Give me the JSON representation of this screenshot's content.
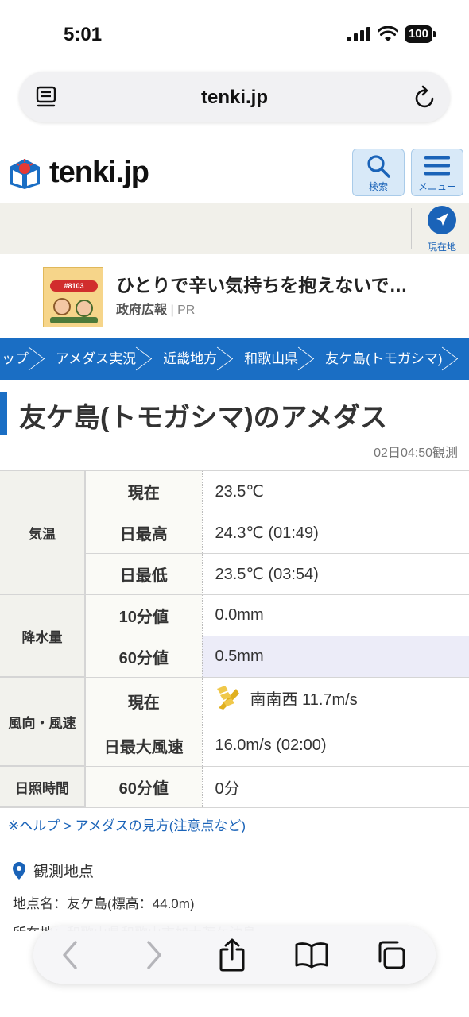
{
  "status_bar": {
    "time": "5:01",
    "battery": "100"
  },
  "browser": {
    "domain": "tenki.jp"
  },
  "site": {
    "logo_text": "tenki.jp",
    "search_label": "検索",
    "menu_label": "メニュー",
    "location_label": "現在地"
  },
  "ad": {
    "badge_text": "#8103",
    "title": "ひとりで辛い気持ちを抱えないで…",
    "sponsor": "政府広報",
    "pr": "PR"
  },
  "breadcrumb": [
    "ップ",
    "アメダス実況",
    "近畿地方",
    "和歌山県",
    "友ケ島(トモガシマ)"
  ],
  "page": {
    "title": "友ケ島(トモガシマ)のアメダス",
    "observed": "02日04:50観測"
  },
  "table": {
    "temp": {
      "category": "気温",
      "rows": [
        {
          "label": "現在",
          "value": "23.5℃"
        },
        {
          "label": "日最高",
          "value": "24.3℃ (01:49)"
        },
        {
          "label": "日最低",
          "value": "23.5℃ (03:54)"
        }
      ]
    },
    "precip": {
      "category": "降水量",
      "rows": [
        {
          "label": "10分値",
          "value": "0.0mm"
        },
        {
          "label": "60分値",
          "value": "0.5mm"
        }
      ]
    },
    "wind": {
      "category": "風向・風速",
      "rows": [
        {
          "label": "現在",
          "value": "南南西 11.7m/s"
        },
        {
          "label": "日最大風速",
          "value": "16.0m/s (02:00)"
        }
      ]
    },
    "sun": {
      "category": "日照時間",
      "rows": [
        {
          "label": "60分値",
          "value": "0分"
        }
      ]
    }
  },
  "help_link": "※ヘルプ > アメダスの見方(注意点など)",
  "station": {
    "heading": "観測地点",
    "name_line": "地点名：友ケ島(標高：44.0m)",
    "address_line": "所在地：和歌山県和歌山市加太苫ケ沖島"
  },
  "colors": {
    "accent": "#1a6ec4",
    "link": "#1a63b8",
    "wind_icon": "#e0b020"
  }
}
